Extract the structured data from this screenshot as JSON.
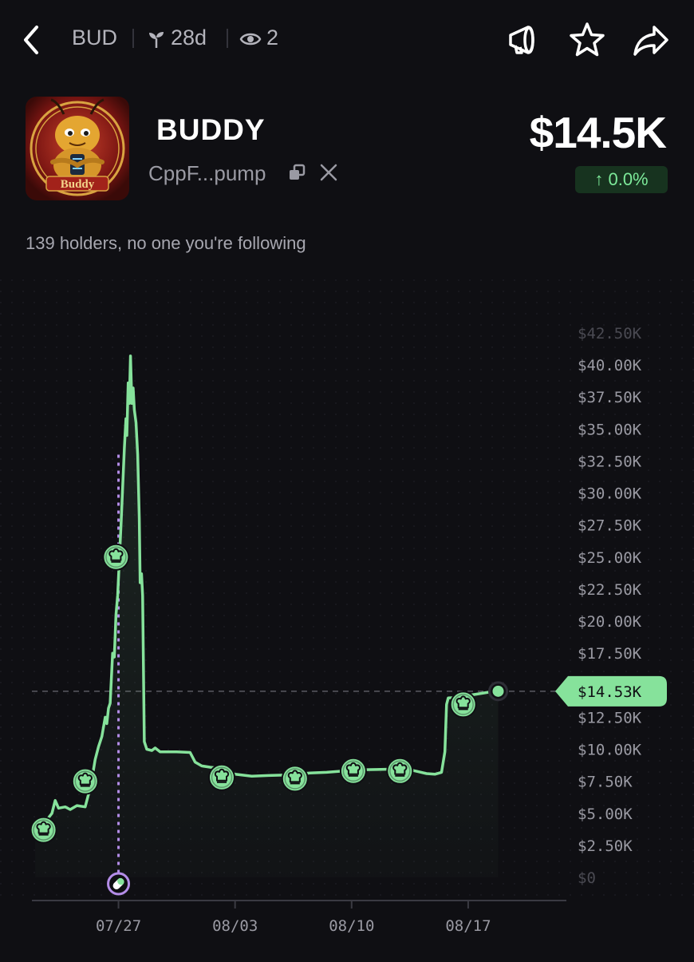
{
  "header": {
    "ticker": "BUD",
    "age": "28d",
    "watchers": "2"
  },
  "token": {
    "name": "BUDDY",
    "address": "CppF...pump",
    "avatar_caption": "Buddy",
    "price": "$14.5K",
    "change": "↑ 0.0%",
    "holders_text": "139 holders, no one you're following"
  },
  "colors": {
    "background": "#0f0f13",
    "line": "#86e29b",
    "change_badge_bg": "#17331f",
    "change_text": "#7dea9a",
    "migration_marker": "#b48de8"
  },
  "icons": {
    "back": "chevron-left-icon",
    "age": "sprout-icon",
    "watchers": "eye-icon",
    "alert": "megaphone-icon",
    "favorite": "star-icon",
    "share": "share-arrow-icon",
    "copy": "copy-icon",
    "social": "x-logo-icon",
    "trade_marker": "chef-hat-icon",
    "migration_marker": "pill-icon"
  },
  "chart_data": {
    "type": "line",
    "y_ticks": [
      "$42.50K",
      "$40.00K",
      "$37.50K",
      "$35.00K",
      "$32.50K",
      "$30.00K",
      "$27.50K",
      "$25.00K",
      "$22.50K",
      "$20.00K",
      "$17.50K",
      "$12.50K",
      "$10.00K",
      "$7.50K",
      "$5.00K",
      "$2.50K",
      "$0"
    ],
    "x_ticks": [
      "07/27",
      "08/03",
      "08/10",
      "08/17"
    ],
    "x_tick_days": [
      0,
      7,
      14,
      21
    ],
    "ylim": [
      0,
      42500
    ],
    "xlim": [
      -5.2,
      26.8
    ],
    "current_value_label": "$14.53K",
    "current_value": 14530,
    "migration_day": 0,
    "series": [
      {
        "points": [
          [
            -5.0,
            4200
          ],
          [
            -4.3,
            4500
          ],
          [
            -4.0,
            5000
          ],
          [
            -3.8,
            6000
          ],
          [
            -3.6,
            5400
          ],
          [
            -3.2,
            5500
          ],
          [
            -2.9,
            5300
          ],
          [
            -2.5,
            5600
          ],
          [
            -2.0,
            5500
          ],
          [
            -1.8,
            6500
          ],
          [
            -1.7,
            7400
          ],
          [
            -1.5,
            8400
          ],
          [
            -1.4,
            9200
          ],
          [
            -1.2,
            10200
          ],
          [
            -1.0,
            11000
          ],
          [
            -0.8,
            12500
          ],
          [
            -0.7,
            12000
          ],
          [
            -0.6,
            13200
          ],
          [
            -0.5,
            13600
          ],
          [
            -0.45,
            15000
          ],
          [
            -0.35,
            17500
          ],
          [
            -0.25,
            17200
          ],
          [
            -0.15,
            20500
          ],
          [
            -0.05,
            22000
          ],
          [
            0.05,
            24800
          ],
          [
            0.15,
            27500
          ],
          [
            0.25,
            30500
          ],
          [
            0.35,
            33500
          ],
          [
            0.45,
            35800
          ],
          [
            0.5,
            34500
          ],
          [
            0.58,
            38600
          ],
          [
            0.65,
            37000
          ],
          [
            0.72,
            40700
          ],
          [
            0.8,
            37000
          ],
          [
            0.88,
            38200
          ],
          [
            0.95,
            36500
          ],
          [
            1.05,
            35500
          ],
          [
            1.15,
            33000
          ],
          [
            1.25,
            28000
          ],
          [
            1.3,
            23000
          ],
          [
            1.38,
            23700
          ],
          [
            1.45,
            22000
          ],
          [
            1.55,
            10600
          ],
          [
            1.7,
            10000
          ],
          [
            2.0,
            9900
          ],
          [
            2.2,
            10100
          ],
          [
            2.5,
            9800
          ],
          [
            3.5,
            9800
          ],
          [
            4.3,
            9750
          ],
          [
            4.6,
            9000
          ],
          [
            5.0,
            8700
          ],
          [
            5.5,
            8600
          ],
          [
            6.2,
            8500
          ],
          [
            7.0,
            8050
          ],
          [
            8.0,
            7900
          ],
          [
            9.0,
            7950
          ],
          [
            10.3,
            8000
          ],
          [
            11.5,
            8150
          ],
          [
            12.5,
            8200
          ],
          [
            13.5,
            8300
          ],
          [
            14.5,
            8400
          ],
          [
            15.5,
            8420
          ],
          [
            16.5,
            8450
          ],
          [
            17.5,
            8400
          ],
          [
            18.0,
            8250
          ],
          [
            18.5,
            8100
          ],
          [
            19.0,
            8050
          ],
          [
            19.4,
            8200
          ],
          [
            19.6,
            9800
          ],
          [
            19.7,
            13500
          ],
          [
            19.8,
            14000
          ],
          [
            20.5,
            14050
          ],
          [
            21.0,
            14200
          ],
          [
            21.5,
            14300
          ],
          [
            22.2,
            14450
          ],
          [
            22.8,
            14530
          ]
        ]
      }
    ],
    "trade_markers": [
      [
        -4.5,
        3700
      ],
      [
        -2.0,
        7500
      ],
      [
        -0.15,
        25000
      ],
      [
        6.2,
        7800
      ],
      [
        10.6,
        7700
      ],
      [
        14.1,
        8300
      ],
      [
        16.9,
        8300
      ],
      [
        20.7,
        13500
      ]
    ],
    "current_point": [
      22.8,
      14530
    ]
  }
}
